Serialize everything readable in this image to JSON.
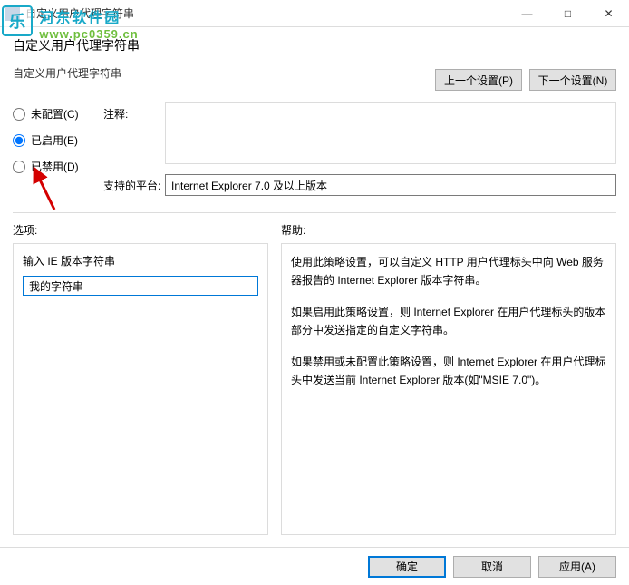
{
  "window": {
    "title": "自定义用户代理字符串",
    "minimize": "—",
    "maximize": "□",
    "close": "✕"
  },
  "watermark": {
    "logo": "乐",
    "cn": "河东软件园",
    "url": "www.pc0359.cn"
  },
  "header": {
    "title": "自定义用户代理字符串",
    "prev": "上一个设置(P)",
    "next": "下一个设置(N)"
  },
  "radios": {
    "not_configured": "未配置(C)",
    "enabled": "已启用(E)",
    "disabled": "已禁用(D)"
  },
  "fields": {
    "comment_label": "注释:",
    "platform_label": "支持的平台:",
    "platform_value": "Internet Explorer 7.0 及以上版本"
  },
  "lower": {
    "options_label": "选项:",
    "help_label": "帮助:",
    "input_label": "输入 IE 版本字符串",
    "input_value": "我的字符串",
    "help_p1": "使用此策略设置，可以自定义 HTTP 用户代理标头中向 Web 服务器报告的 Internet Explorer 版本字符串。",
    "help_p2": "如果启用此策略设置，则 Internet Explorer 在用户代理标头的版本部分中发送指定的自定义字符串。",
    "help_p3": "如果禁用或未配置此策略设置，则 Internet Explorer 在用户代理标头中发送当前 Internet Explorer 版本(如\"MSIE 7.0\")。"
  },
  "footer": {
    "ok": "确定",
    "cancel": "取消",
    "apply": "应用(A)"
  }
}
